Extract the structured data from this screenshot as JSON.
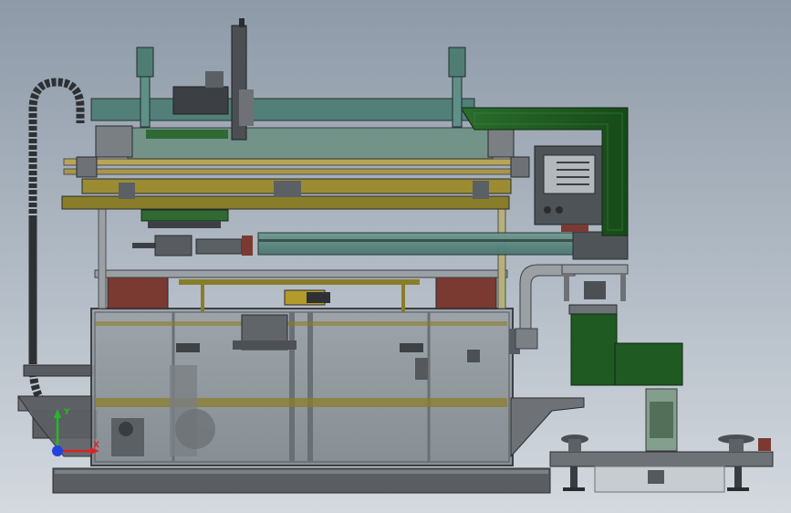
{
  "viewport": {
    "background_top": "#8e9aa8",
    "background_bottom": "#d4d9df"
  },
  "triad": {
    "axis_y_label": "Y",
    "axis_x_label": "X",
    "y_color": "#22bb22",
    "x_color": "#dd2222",
    "z_color": "#2244dd"
  },
  "colors": {
    "frame_gray": "#6e7276",
    "olive_rail": "#8a7d2a",
    "teal_glass": "#5f8a82",
    "dark_green": "#1f5a22",
    "brick_red": "#7a3a32",
    "glass_gray": "#8c9499",
    "steel_dark": "#3c4044"
  }
}
